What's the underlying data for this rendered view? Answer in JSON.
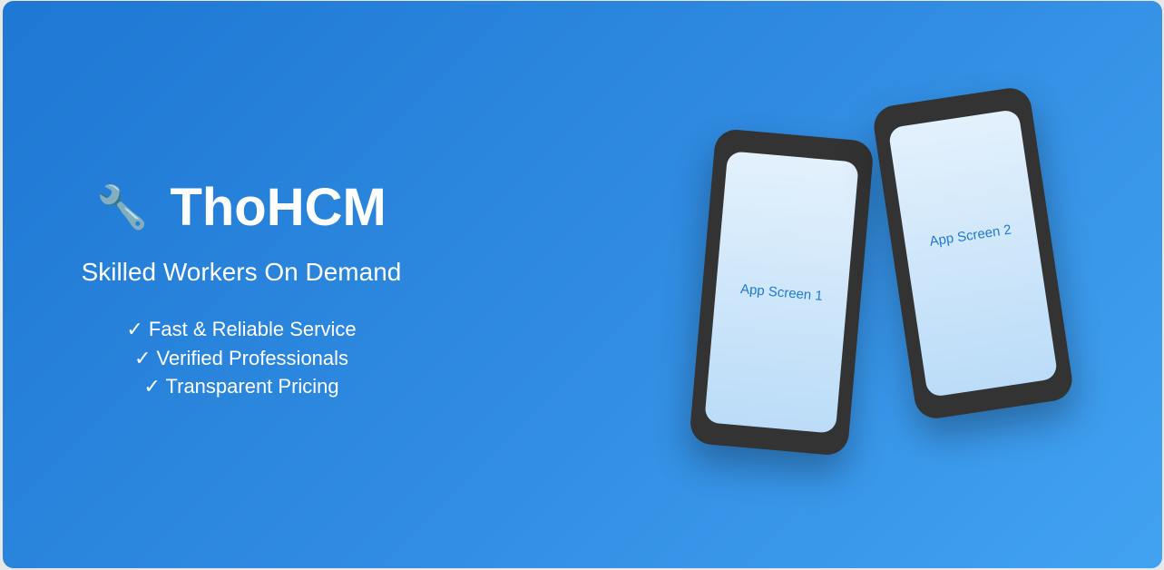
{
  "brand": {
    "icon": "wrench-icon",
    "icon_glyph": "🔧",
    "name": "ThoHCM",
    "tagline": "Skilled Workers On Demand"
  },
  "features": [
    "✓ Fast & Reliable Service",
    "✓ Verified Professionals",
    "✓ Transparent Pricing"
  ],
  "phones": [
    {
      "label": "App Screen 1"
    },
    {
      "label": "App Screen 2"
    }
  ],
  "colors": {
    "gradient_start": "#1e78d4",
    "gradient_end": "#42a2f2",
    "phone_frame": "#333333",
    "screen_text": "#1e78d4"
  }
}
